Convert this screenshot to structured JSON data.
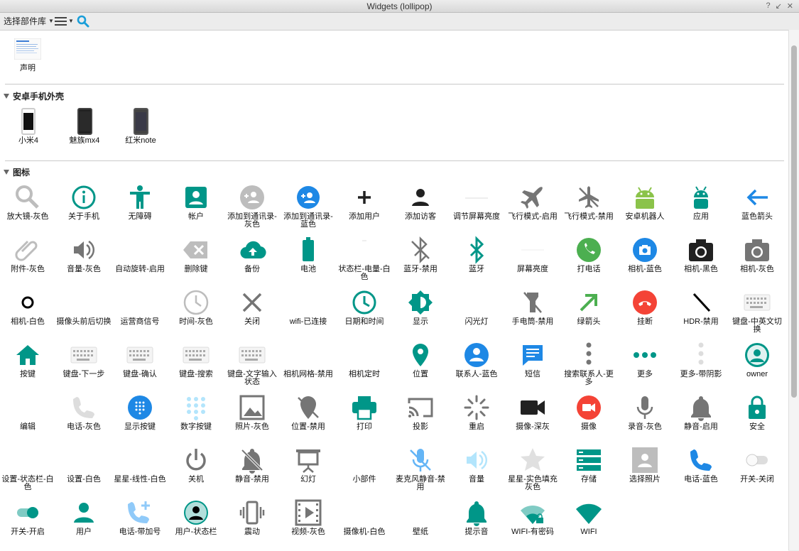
{
  "window": {
    "title": "Widgets (lollipop)",
    "controls": [
      "?",
      "↙",
      "✕"
    ]
  },
  "toolbar": {
    "library_select": "选择部件库"
  },
  "statement": {
    "label": "声明"
  },
  "sections": [
    {
      "title": "安卓手机外壳",
      "items": [
        "小米4",
        "魅族mx4",
        "红米note"
      ]
    },
    {
      "title": "图标"
    }
  ],
  "icons": [
    "放大镜-灰色",
    "关于手机",
    "无障碍",
    "帐户",
    "添加到通讯录-灰色",
    "添加到通讯录-蓝色",
    "添加用户",
    "添加访客",
    "调节屏幕亮度",
    "飞行模式-启用",
    "飞行模式-禁用",
    "安卓机器人",
    "应用",
    "蓝色箭头",
    "附件-灰色",
    "音量-灰色",
    "自动旋转-启用",
    "删除键",
    "备份",
    "电池",
    "状态栏-电量-白色",
    "蓝牙-禁用",
    "蓝牙",
    "屏幕亮度",
    "打电话",
    "相机-蓝色",
    "相机-黑色",
    "相机-灰色",
    "相机-白色",
    "摄像头前后切换",
    "运营商信号",
    "时间-灰色",
    "关闭",
    "wifi-已连接",
    "日期和时间",
    "显示",
    "闪光灯",
    "手电筒-禁用",
    "绿箭头",
    "挂断",
    "HDR-禁用",
    "键盘-中英文切换",
    "按键",
    "键盘-下一步",
    "键盘-确认",
    "键盘-搜索",
    "键盘-文字输入状态",
    "相机网格-禁用",
    "相机定时",
    "位置",
    "联系人-蓝色",
    "短信",
    "搜索联系人-更多",
    "更多",
    "更多-带阴影",
    "owner",
    "编辑",
    "电话-灰色",
    "显示按键",
    "数字按键",
    "照片-灰色",
    "位置-禁用",
    "打印",
    "投影",
    "重启",
    "摄像-深灰",
    "摄像",
    "录音-灰色",
    "静音-启用",
    "安全",
    "设置-状态栏-白色",
    "设置-白色",
    "星星-线性-白色",
    "关机",
    "静音-禁用",
    "幻灯",
    "小部件",
    "麦克风静音-禁用",
    "音量",
    "星星-实色填充灰色",
    "存储",
    "选择照片",
    "电话-蓝色",
    "开关-关闭",
    "开关-开启",
    "用户",
    "电话-带加号",
    "用户-状态栏",
    "震动",
    "视频-灰色",
    "摄像机-白色",
    "壁纸",
    "提示音",
    "WIFI-有密码",
    "WIFI"
  ],
  "icon_names": [
    "magnifier-gray-icon",
    "info-icon",
    "accessibility-icon",
    "account-icon",
    "add-contact-gray-icon",
    "add-contact-blue-icon",
    "add-user-icon",
    "add-guest-icon",
    "brightness-adjust-icon",
    "airplane-on-icon",
    "airplane-off-icon",
    "android-robot-icon",
    "apps-icon",
    "blue-arrow-icon",
    "attachment-icon",
    "volume-gray-icon",
    "auto-rotate-icon",
    "backspace-icon",
    "backup-icon",
    "battery-icon",
    "statusbar-battery-icon",
    "bluetooth-off-icon",
    "bluetooth-icon",
    "screen-brightness-icon",
    "call-icon",
    "camera-blue-icon",
    "camera-black-icon",
    "camera-gray-icon",
    "camera-white-icon",
    "camera-switch-icon",
    "carrier-signal-icon",
    "clock-gray-icon",
    "close-icon",
    "wifi-connected-icon",
    "date-time-icon",
    "display-icon",
    "flash-icon",
    "flashlight-off-icon",
    "green-arrow-icon",
    "hangup-icon",
    "hdr-off-icon",
    "keyboard-lang-switch-icon",
    "home-key-icon",
    "keyboard-next-icon",
    "keyboard-confirm-icon",
    "keyboard-search-icon",
    "keyboard-input-icon",
    "camera-grid-off-icon",
    "camera-timer-icon",
    "location-icon",
    "contact-blue-icon",
    "sms-icon",
    "search-contact-more-icon",
    "more-icon",
    "more-shadow-icon",
    "owner-icon",
    "edit-icon",
    "phone-gray-icon",
    "show-keypad-icon",
    "number-keypad-icon",
    "photo-gray-icon",
    "location-off-icon",
    "print-icon",
    "cast-icon",
    "restart-icon",
    "video-darkgray-icon",
    "video-record-icon",
    "mic-gray-icon",
    "mute-on-icon",
    "security-icon",
    "settings-statusbar-icon",
    "settings-white-icon",
    "star-outline-icon",
    "power-icon",
    "mute-off-icon",
    "slideshow-icon",
    "widget-icon",
    "mic-mute-off-icon",
    "volume-icon",
    "star-filled-icon",
    "storage-icon",
    "select-photo-icon",
    "phone-blue-icon",
    "switch-off-icon",
    "switch-on-icon",
    "user-icon",
    "phone-add-icon",
    "user-statusbar-icon",
    "vibrate-icon",
    "video-gray-icon",
    "camcorder-white-icon",
    "wallpaper-icon",
    "notification-sound-icon",
    "wifi-locked-icon",
    "wifi-icon"
  ],
  "colors": {
    "teal": "#009688",
    "gray": "#757575",
    "lightgray": "#bdbdbd",
    "blue": "#1e88e5",
    "green": "#4caf50",
    "android_green": "#8bc34a",
    "red": "#f44336",
    "dark": "#212121",
    "search_blue": "#1a9ed9"
  }
}
